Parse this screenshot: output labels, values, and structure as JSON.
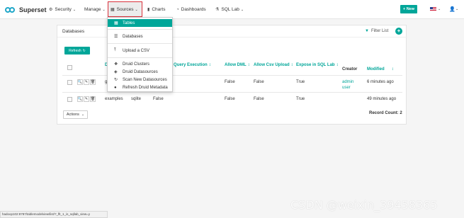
{
  "brand": {
    "name": "Superset"
  },
  "nav": {
    "security": "Security",
    "manage": "Manage",
    "sources": "Sources",
    "charts": "Charts",
    "dashboards": "Dashboards",
    "sql_lab": "SQL Lab",
    "new_button": "+ New"
  },
  "sources_menu": {
    "items": [
      "Tables",
      "Databases",
      "Upload a CSV",
      "Druid Clusters",
      "Druid Datasources",
      "Scan New Datasources",
      "Refresh Druid Metadata"
    ]
  },
  "panel": {
    "title": "Databases",
    "filter_list": "Filter List",
    "refresh_button": "Refresh"
  },
  "table": {
    "columns": [
      "D",
      "nous Query Execution",
      "Allow DML",
      "Allow Csv Upload",
      "Expose in SQL Lab",
      "Creator",
      "Modified"
    ],
    "rows": [
      {
        "database": "g",
        "backend": "",
        "async": "",
        "allow_dml": "False",
        "allow_csv": "False",
        "expose": "True",
        "creator": "admin user",
        "modified": "6 minutes ago"
      },
      {
        "database": "examples",
        "backend": "sqlite",
        "async": "False",
        "allow_dml": "False",
        "allow_csv": "False",
        "expose": "True",
        "creator": "",
        "modified": "49 minutes ago"
      }
    ]
  },
  "footer": {
    "actions_button": "Actions",
    "record_count": "Record Count: 2"
  },
  "status_bar": {
    "url": "hadoop102:8787/tablemodelview/list/?_flt_1_is_sqllab_view=y"
  },
  "watermark": "CSDN @weixin_39458365",
  "colors": {
    "accent": "#00a699",
    "highlight": "#d9303b"
  }
}
